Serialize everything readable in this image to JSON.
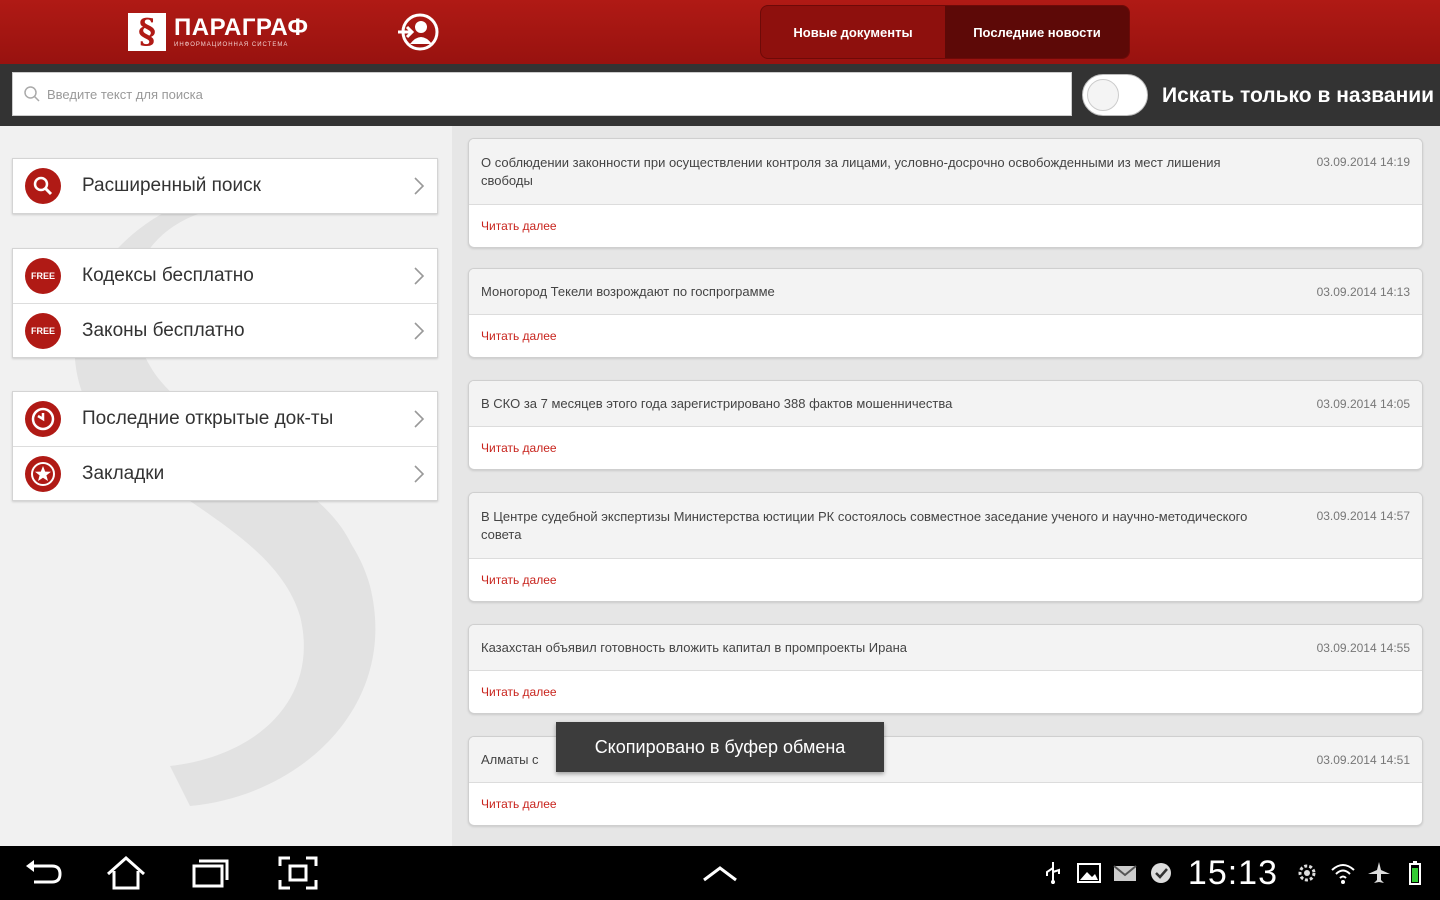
{
  "header": {
    "logo_title": "ПАРАГРАФ",
    "logo_subtitle": "ИНФОРМАЦИОННАЯ СИСТЕМА",
    "tabs": [
      {
        "label": "Новые документы",
        "active": false
      },
      {
        "label": "Последние новости",
        "active": true
      }
    ]
  },
  "search": {
    "placeholder": "Введите текст для поиска",
    "toggle_label": "Искать только в названии",
    "toggle_on": false
  },
  "menu": {
    "advanced_search": "Расширенный поиск",
    "codes_free": "Кодексы бесплатно",
    "laws_free": "Законы бесплатно",
    "recent_docs": "Последние открытые док-ты",
    "bookmarks": "Закладки",
    "free_badge": "FREE"
  },
  "news": [
    {
      "title": "О соблюдении законности при осуществлении контроля за лицами, условно-досрочно освобожденными из мест лишения свободы",
      "date": "03.09.2014 14:19",
      "more": "Читать далее"
    },
    {
      "title": "Моногород Текели возрождают по госпрограмме",
      "date": "03.09.2014 14:13",
      "more": "Читать далее"
    },
    {
      "title": "В СКО за 7 месяцев этого года зарегистрировано 388 фактов мошенничества",
      "date": "03.09.2014 14:05",
      "more": "Читать далее"
    },
    {
      "title": "В Центре судебной экспертизы Министерства юстиции РК состоялось совместное заседание ученого и научно-методического совета",
      "date": "03.09.2014 14:57",
      "more": "Читать далее"
    },
    {
      "title": "Казахстан объявил готовность вложить капитал в промпроекты Ирана",
      "date": "03.09.2014 14:55",
      "more": "Читать далее"
    },
    {
      "title": "Алматы с",
      "date": "03.09.2014 14:51",
      "more": "Читать далее"
    }
  ],
  "toast": "Скопировано в буфер обмена",
  "statusbar": {
    "time": "15:13"
  },
  "colors": {
    "brand_red": "#b01a15",
    "link_red": "#c8241d",
    "searchbar_bg": "#333333"
  }
}
